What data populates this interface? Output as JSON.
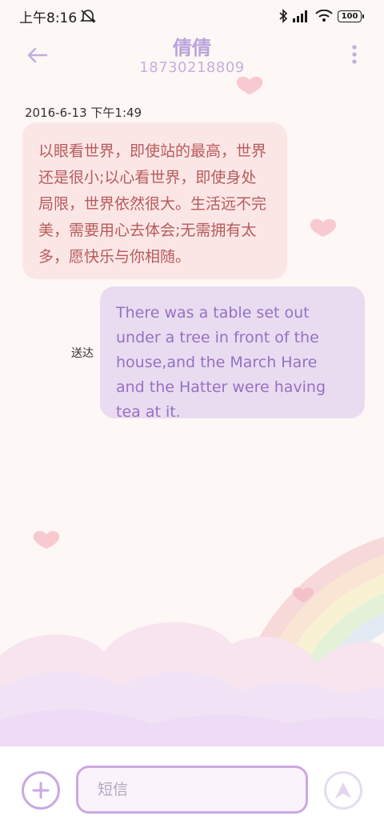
{
  "status_bar": {
    "time": "上午8:16",
    "battery": "100"
  },
  "header": {
    "contact_name": "倩倩",
    "contact_number": "18730218809"
  },
  "conversation": {
    "timestamp": "2016-6-13 下午1:49",
    "incoming_message": "以眼看世界，即使站的最高，世界还是很小;以心看世界，即使身处局限，世界依然很大。生活远不完美，需要用心去体会;无需拥有太多，愿快乐与你相随。",
    "outgoing_message": "There was a table set out under a tree in front of the house,and the March Hare and the Hatter were having tea at it.",
    "outgoing_status": "送达"
  },
  "composer": {
    "placeholder": "短信"
  },
  "icons": {
    "back": "arrow-left-icon",
    "more": "more-vertical-icon",
    "add": "plus-icon",
    "send": "send-arrow-icon"
  },
  "colors": {
    "accent": "#c9a9e2",
    "title": "#b9a3da",
    "incoming_bubble": "#fbe6e6",
    "incoming_text": "#b85b5b",
    "outgoing_bubble": "#e9dcf1",
    "outgoing_text": "#9671c2"
  }
}
